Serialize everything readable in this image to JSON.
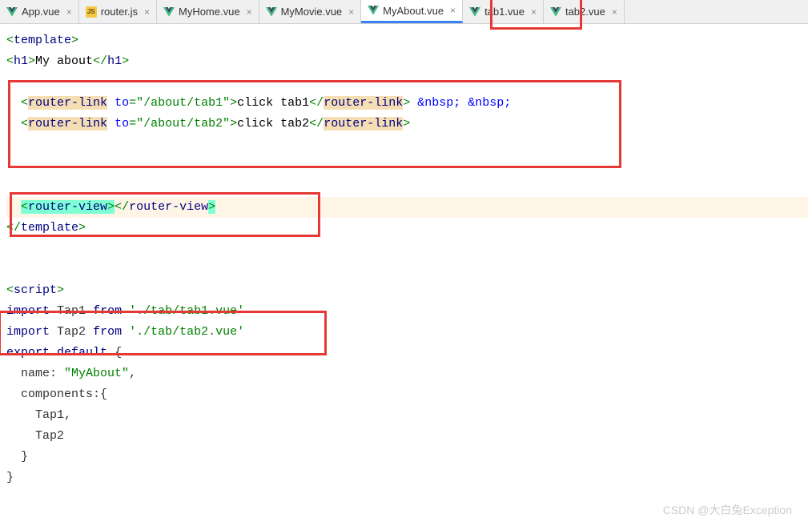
{
  "tabs": [
    {
      "type": "vue",
      "label": "App.vue"
    },
    {
      "type": "js",
      "label": "router.js"
    },
    {
      "type": "vue",
      "label": "MyHome.vue"
    },
    {
      "type": "vue",
      "label": "MyMovie.vue"
    },
    {
      "type": "vue",
      "label": "MyAbout.vue",
      "active": true
    },
    {
      "type": "vue",
      "label": "tab1.vue"
    },
    {
      "type": "vue",
      "label": "tab2.vue"
    }
  ],
  "code": {
    "template_open": "template",
    "h1_tag": "h1",
    "h1_text": "My about",
    "router_link": "router-link",
    "to_attr": "to",
    "to_val1": "\"/about/tab1\"",
    "to_val2": "\"/about/tab2\"",
    "link_text1": "click tab1",
    "link_text2": "click tab2",
    "nbsp": " &nbsp; &nbsp;",
    "router_view": "router-view",
    "template_close": "template",
    "script_tag": "script",
    "import_kw": "import",
    "from_kw": "from",
    "tap1": "Tap1",
    "tap2": "Tap2",
    "path1": "'./tab/tab1.vue'",
    "path2": "'./tab/tab2.vue'",
    "export": "export",
    "default": "default",
    "name_key": "name",
    "name_val": "\"MyAbout\"",
    "components": "components",
    "comp1": "Tap1",
    "comp2": "Tap2"
  },
  "watermark": "CSDN @大白兔Exception"
}
